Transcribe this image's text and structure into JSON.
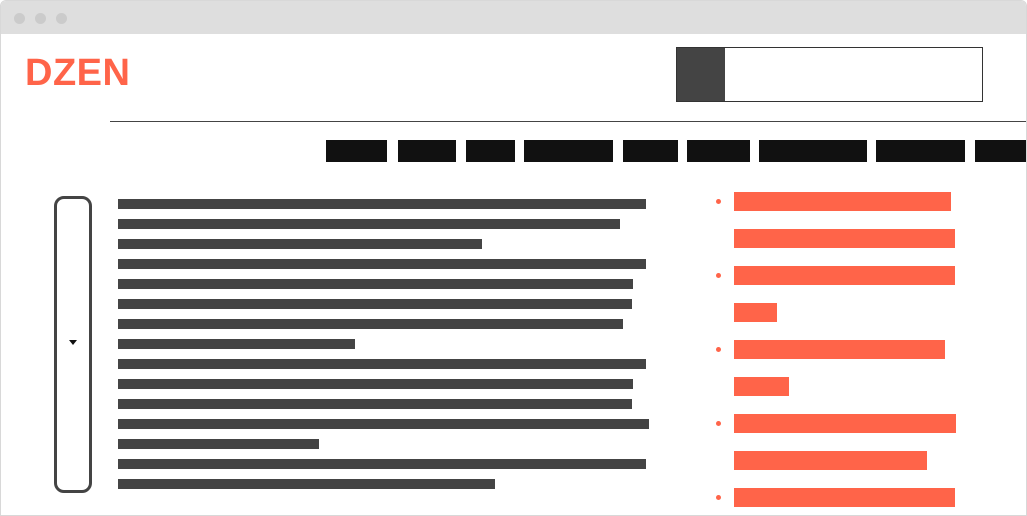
{
  "window": {
    "controls": [
      "close-dot",
      "minimize-dot",
      "maximize-dot"
    ]
  },
  "header": {
    "logo_text": "DZEN",
    "search": {
      "placeholder": "",
      "value": ""
    }
  },
  "colors": {
    "accent": "#ff6449",
    "dark_block": "#111111",
    "text_placeholder": "#444444",
    "titlebar": "#dedede",
    "window_dot": "#cbcbcb"
  },
  "nav": {
    "item_count": 9
  },
  "article": {
    "line_count": 15
  },
  "related": {
    "item_count": 5
  }
}
